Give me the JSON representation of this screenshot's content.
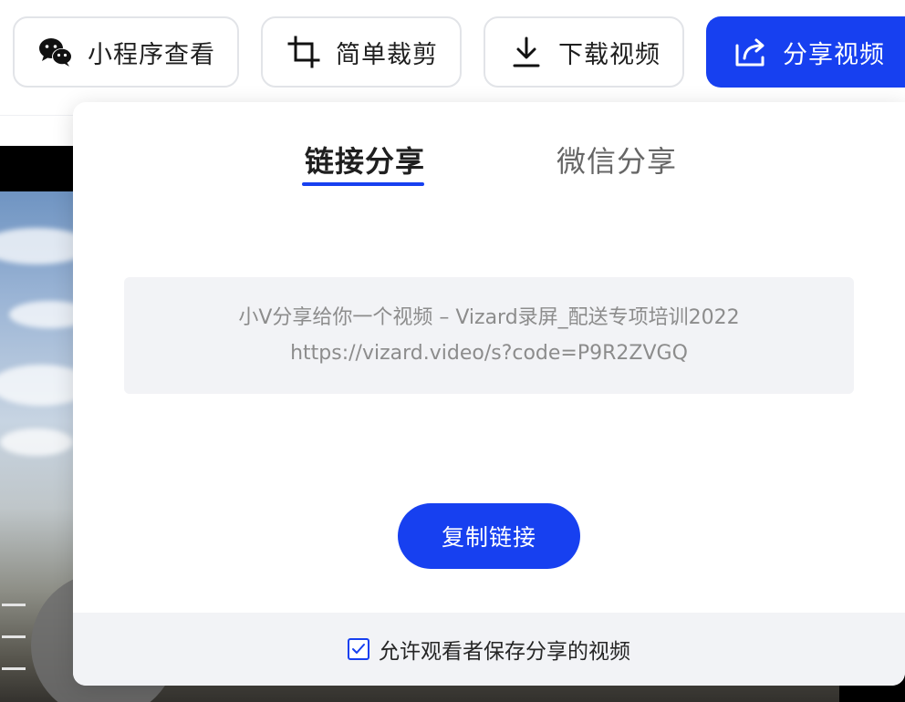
{
  "toolbar": {
    "mini_program_label": "小程序查看",
    "crop_label": "简单裁剪",
    "download_label": "下载视频",
    "share_label": "分享视频"
  },
  "share_panel": {
    "tabs": [
      {
        "label": "链接分享",
        "active": true
      },
      {
        "label": "微信分享",
        "active": false
      }
    ],
    "link_text_line1": "小V分享给你一个视频 – Vizard录屏_配送专项培训2022",
    "link_text_line2": "https://vizard.video/s?code=P9R2ZVGQ",
    "copy_button_label": "复制链接",
    "allow_save_label": "允许观看者保存分享的视频",
    "allow_save_checked": true
  },
  "icons": {
    "mini_program": "wechat-icon",
    "crop": "crop-icon",
    "download": "download-icon",
    "share": "share-icon",
    "checkbox": "check-icon"
  },
  "colors": {
    "accent": "#1740f0",
    "panel_gray": "#f2f3f6",
    "border": "#e2e4e8"
  }
}
